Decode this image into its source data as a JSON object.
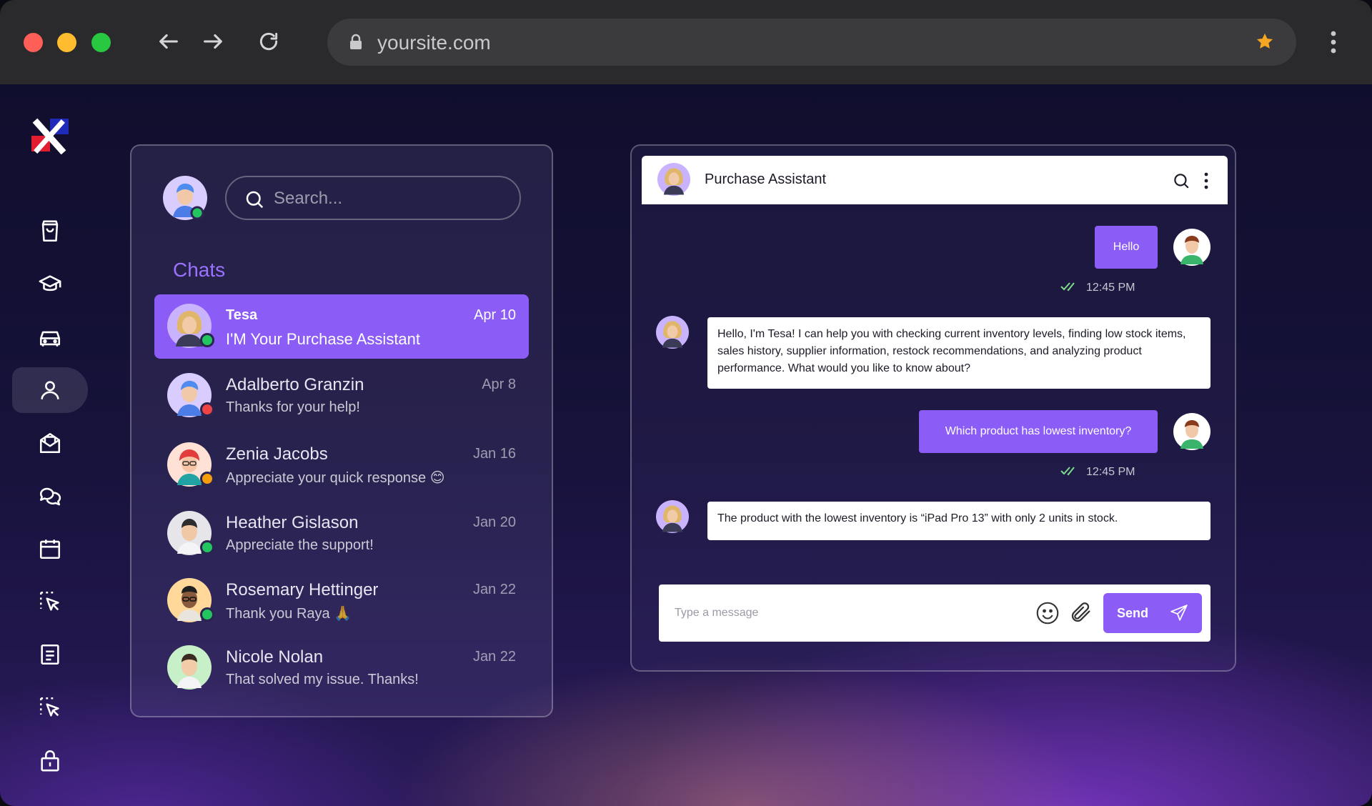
{
  "browser": {
    "url": "yoursite.com"
  },
  "sidebar": {
    "items": [
      {
        "icon": "shopping-bag-icon"
      },
      {
        "icon": "graduation-cap-icon"
      },
      {
        "icon": "car-icon"
      },
      {
        "icon": "user-icon",
        "active": true
      },
      {
        "icon": "mail-open-icon"
      },
      {
        "icon": "chat-bubbles-icon"
      },
      {
        "icon": "calendar-icon"
      },
      {
        "icon": "select-cursor-icon"
      },
      {
        "icon": "document-icon"
      },
      {
        "icon": "select-cursor-icon"
      },
      {
        "icon": "lock-icon"
      }
    ]
  },
  "chats_panel": {
    "search_placeholder": "Search...",
    "title": "Chats",
    "chats": [
      {
        "name": "Tesa",
        "preview": "I'M Your Purchase  Assistant",
        "date": "Apr 10",
        "status_color": "#22c55e",
        "active": true
      },
      {
        "name": "Adalberto Granzin",
        "preview": "Thanks for your help!",
        "date": "Apr 8",
        "status_color": "#ef4444"
      },
      {
        "name": "Zenia Jacobs",
        "preview": "Appreciate your quick response 😊",
        "date": "Jan 16",
        "status_color": "#f59e0b"
      },
      {
        "name": "Heather Gislason",
        "preview": "Appreciate the support!",
        "date": "Jan 20",
        "status_color": "#22c55e"
      },
      {
        "name": "Rosemary Hettinger",
        "preview": "Thank you Raya  🙏",
        "date": "Jan 22",
        "status_color": "#22c55e"
      },
      {
        "name": "Nicole Nolan",
        "preview": "That solved my issue. Thanks!",
        "date": "Jan 22",
        "status_color": null
      }
    ]
  },
  "conversation": {
    "title": "Purchase Assistant",
    "messages": [
      {
        "direction": "out",
        "text": "Hello",
        "time": "12:45 PM"
      },
      {
        "direction": "in",
        "text": "Hello, I'm Tesa! I can help you with checking current inventory levels, finding low stock items, sales history, supplier information, restock recommendations, and analyzing product performance. What would you like to know about?"
      },
      {
        "direction": "out",
        "text": "Which product has lowest inventory?",
        "time": "12:45 PM"
      },
      {
        "direction": "in",
        "text": "The product with the lowest inventory is “iPad Pro 13” with only 2 units in stock."
      }
    ],
    "composer": {
      "placeholder": "Type a message",
      "send_label": "Send"
    }
  },
  "colors": {
    "accent": "#8b5cf6",
    "chats_title": "#9b72ff"
  }
}
